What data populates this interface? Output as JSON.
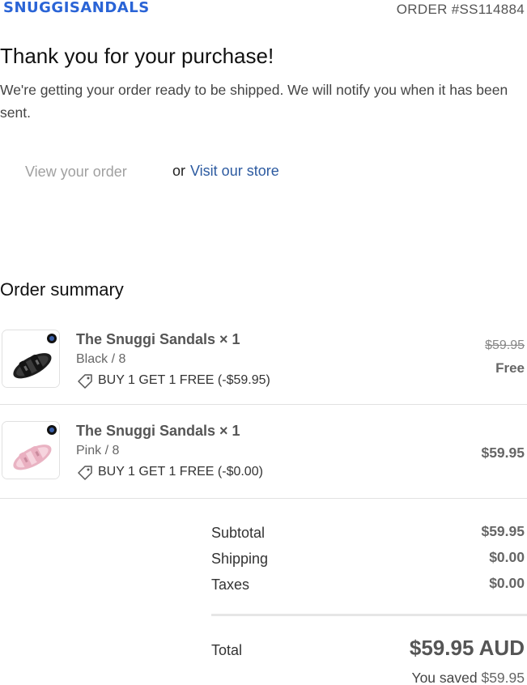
{
  "header": {
    "logo": "SNUGGISANDALS",
    "order_number": "ORDER #SS114884"
  },
  "confirmation": {
    "title": "Thank you for your purchase!",
    "message": "We're getting your order ready to be shipped. We will notify you when it has been sent."
  },
  "actions": {
    "view_order": "View your order",
    "or": "or",
    "visit_store": "Visit our store"
  },
  "summary": {
    "title": "Order summary",
    "items": [
      {
        "name": "The Snuggi Sandals × 1",
        "variant": "Black / 8",
        "discount": "BUY 1 GET 1 FREE (-$59.95)",
        "original_price": "$59.95",
        "price": "Free",
        "image_color": "#2b2b2b"
      },
      {
        "name": "The Snuggi Sandals × 1",
        "variant": "Pink / 8",
        "discount": "BUY 1 GET 1 FREE (-$0.00)",
        "price": "$59.95",
        "image_color": "#f2c4d0"
      }
    ]
  },
  "totals": {
    "subtotal_label": "Subtotal",
    "subtotal": "$59.95",
    "shipping_label": "Shipping",
    "shipping": "$0.00",
    "taxes_label": "Taxes",
    "taxes": "$0.00",
    "total_label": "Total",
    "total": "$59.95 AUD",
    "saved_label": "You saved",
    "saved": "$59.95"
  },
  "colors": {
    "brand": "#2a64d6",
    "link": "#2c5aa0"
  }
}
